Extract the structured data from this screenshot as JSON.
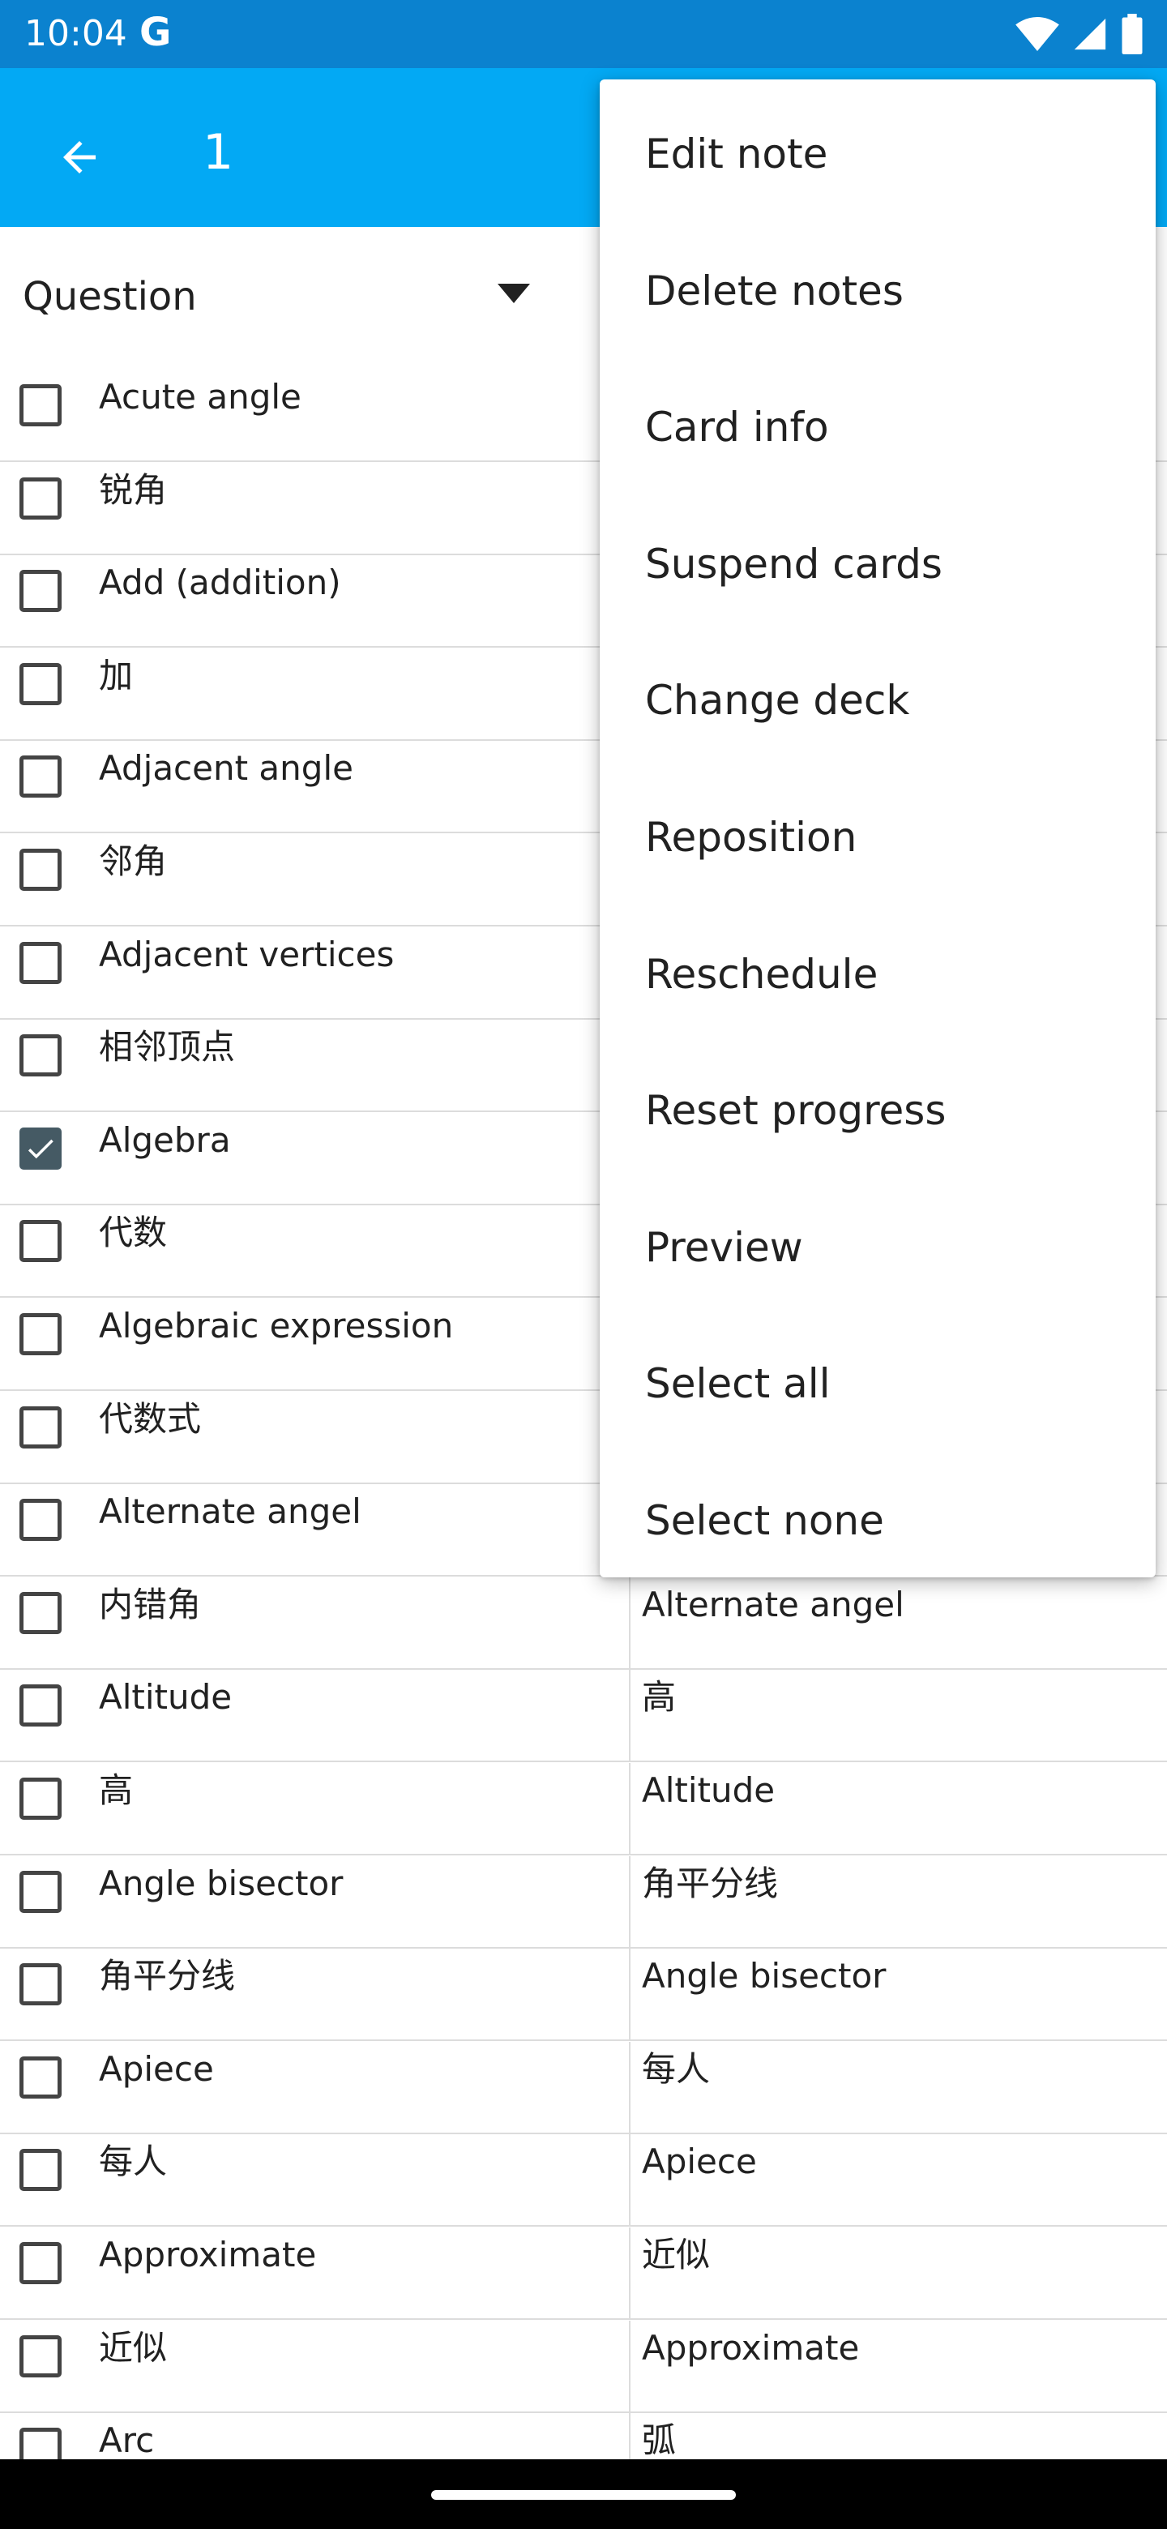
{
  "status_bar": {
    "time": "10:04",
    "carrier_glyph": "G",
    "icons": [
      "wifi-icon",
      "signal-icon",
      "battery-icon"
    ]
  },
  "app_bar": {
    "title": "1",
    "back_icon": "arrow-back-icon"
  },
  "columns": {
    "left": "Question",
    "right": ""
  },
  "rows": [
    {
      "col1": "Acute angle",
      "col2": "",
      "checked": false
    },
    {
      "col1": "锐角",
      "col2": "",
      "checked": false
    },
    {
      "col1": "Add (addition)",
      "col2": "",
      "checked": false
    },
    {
      "col1": "加",
      "col2": "",
      "checked": false
    },
    {
      "col1": "Adjacent angle",
      "col2": "",
      "checked": false
    },
    {
      "col1": "邻角",
      "col2": "",
      "checked": false
    },
    {
      "col1": "Adjacent vertices",
      "col2": "",
      "checked": false
    },
    {
      "col1": "相邻顶点",
      "col2": "",
      "checked": false
    },
    {
      "col1": "Algebra",
      "col2": "",
      "checked": true
    },
    {
      "col1": "代数",
      "col2": "",
      "checked": false
    },
    {
      "col1": "Algebraic expression",
      "col2": "",
      "checked": false
    },
    {
      "col1": "代数式",
      "col2": "",
      "checked": false
    },
    {
      "col1": "Alternate angel",
      "col2": "",
      "checked": false
    },
    {
      "col1": "内错角",
      "col2": "Alternate angel",
      "checked": false
    },
    {
      "col1": "Altitude",
      "col2": "高",
      "checked": false
    },
    {
      "col1": "高",
      "col2": "Altitude",
      "checked": false
    },
    {
      "col1": "Angle bisector",
      "col2": "角平分线",
      "checked": false
    },
    {
      "col1": "角平分线",
      "col2": "Angle bisector",
      "checked": false
    },
    {
      "col1": "Apiece",
      "col2": "每人",
      "checked": false
    },
    {
      "col1": "每人",
      "col2": "Apiece",
      "checked": false
    },
    {
      "col1": "Approximate",
      "col2": "近似",
      "checked": false
    },
    {
      "col1": "近似",
      "col2": "Approximate",
      "checked": false
    },
    {
      "col1": "Arc",
      "col2": "弧",
      "checked": false
    }
  ],
  "menu": {
    "items": [
      "Edit note",
      "Delete notes",
      "Card info",
      "Suspend cards",
      "Change deck",
      "Reposition",
      "Reschedule",
      "Reset progress",
      "Preview",
      "Select all",
      "Select none"
    ]
  },
  "colors": {
    "status_bar": "#0b82cf",
    "app_bar": "#03a9f4",
    "checkbox_checked": "#455a64"
  }
}
